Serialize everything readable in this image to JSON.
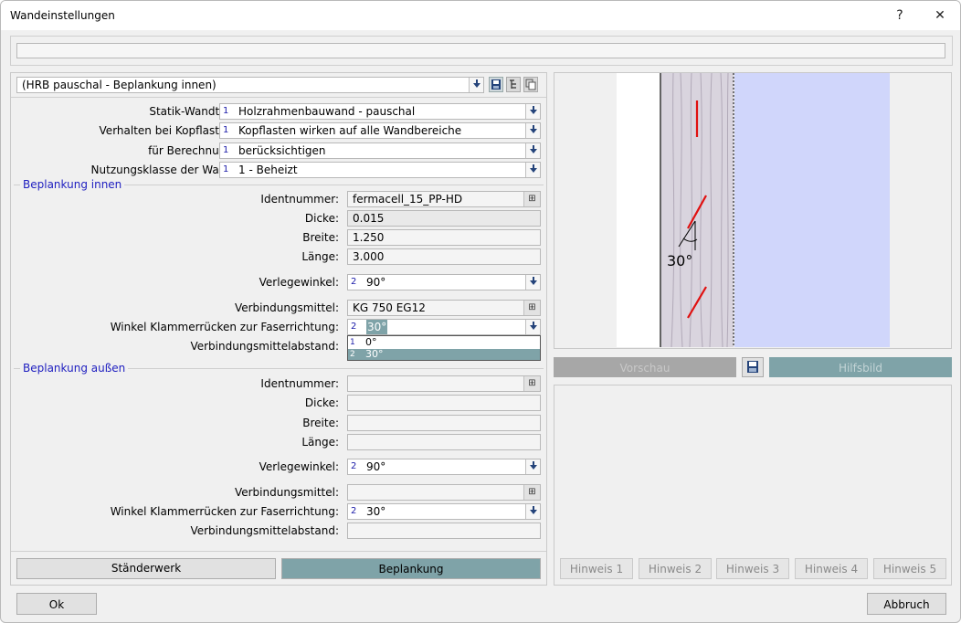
{
  "window": {
    "title": "Wandeinstellungen",
    "help": "?",
    "close": "✕"
  },
  "preset": {
    "value": "(HRB pauschal - Beplankung innen)"
  },
  "general": {
    "rows": [
      {
        "label": "Statik-Wandtyp:",
        "idx": "1",
        "value": "Holzrahmenbauwand - pauschal"
      },
      {
        "label": "Verhalten bei Kopflasten:",
        "idx": "1",
        "value": "Kopflasten wirken auf alle Wandbereiche"
      },
      {
        "label": "für Berechnung:",
        "idx": "1",
        "value": "berücksichtigen"
      },
      {
        "label": "Nutzungsklasse der Wand:",
        "idx": "1",
        "value": "1 - Beheizt"
      }
    ]
  },
  "innen": {
    "title": "Beplankung innen",
    "ident_label": "Identnummer:",
    "ident_value": "fermacell_15_PP-HD",
    "dicke_label": "Dicke:",
    "dicke_value": "0.015",
    "breite_label": "Breite:",
    "breite_value": "1.250",
    "laenge_label": "Länge:",
    "laenge_value": "3.000",
    "verlege_label": "Verlegewinkel:",
    "verlege_idx": "2",
    "verlege_value": "90°",
    "vm_label": "Verbindungsmittel:",
    "vm_value": "KG 750 EG12",
    "winkel_label": "Winkel Klammerrücken zur Faserrichtung:",
    "winkel_idx": "2",
    "winkel_value": "30°",
    "abstand_label": "Verbindungsmittelabstand:",
    "dropdown": [
      {
        "idx": "1",
        "value": "0°"
      },
      {
        "idx": "2",
        "value": "30°"
      }
    ]
  },
  "aussen": {
    "title": "Beplankung außen",
    "ident_label": "Identnummer:",
    "ident_value": "",
    "dicke_label": "Dicke:",
    "breite_label": "Breite:",
    "laenge_label": "Länge:",
    "verlege_label": "Verlegewinkel:",
    "verlege_idx": "2",
    "verlege_value": "90°",
    "vm_label": "Verbindungsmittel:",
    "winkel_label": "Winkel Klammerrücken zur Faserrichtung:",
    "winkel_idx": "2",
    "winkel_value": "30°",
    "abstand_label": "Verbindungsmittelabstand:"
  },
  "tabs": {
    "staenderwerk": "Ständerwerk",
    "beplankung": "Beplankung"
  },
  "preview": {
    "angle_label": "30°",
    "vorschau": "Vorschau",
    "hilfsbild": "Hilfsbild"
  },
  "hinweise": [
    "Hinweis 1",
    "Hinweis 2",
    "Hinweis 3",
    "Hinweis 4",
    "Hinweis 5"
  ],
  "footer": {
    "ok": "Ok",
    "cancel": "Abbruch"
  },
  "colors": {
    "accent_teal": "#7fa3a8",
    "section_blue": "#2020c0",
    "nail_red": "#e01010",
    "board_blue": "#d0d6fb"
  }
}
